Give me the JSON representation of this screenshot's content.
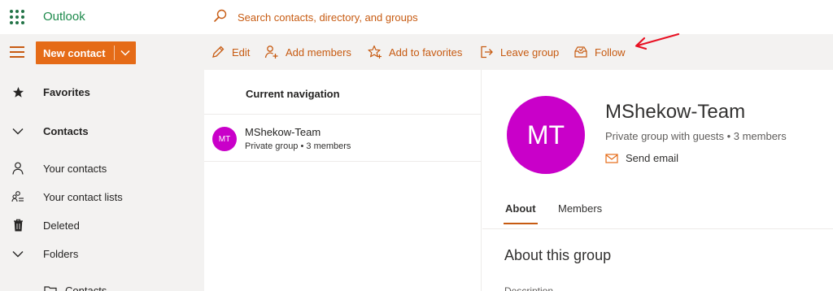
{
  "app": {
    "name": "Outlook"
  },
  "search": {
    "placeholder": "Search contacts, directory, and groups"
  },
  "toolbar": {
    "new_contact_label": "New contact",
    "commands": {
      "edit": "Edit",
      "add_members": "Add members",
      "add_to_favorites": "Add to favorites",
      "leave_group": "Leave group",
      "follow": "Follow"
    }
  },
  "sidebar": {
    "items": [
      {
        "label": "Favorites",
        "icon": "star-icon",
        "bold": true
      },
      {
        "label": "Contacts",
        "icon": "chevron-down-icon",
        "bold": true
      },
      {
        "label": "Your contacts",
        "icon": "person-icon"
      },
      {
        "label": "Your contact lists",
        "icon": "contact-list-icon"
      },
      {
        "label": "Deleted",
        "icon": "trash-icon"
      },
      {
        "label": "Folders",
        "icon": "chevron-down-icon"
      },
      {
        "label": "Contacts",
        "icon": "folder-icon"
      }
    ]
  },
  "list": {
    "header": "Current navigation",
    "items": [
      {
        "initials": "MT",
        "name": "MShekow-Team",
        "subtitle": "Private group • 3 members"
      }
    ]
  },
  "detail": {
    "initials": "MT",
    "name": "MShekow-Team",
    "subtitle": "Private group with guests • 3 members",
    "send_email": "Send email",
    "tabs": [
      "About",
      "Members"
    ],
    "active_tab": "About",
    "about_title": "About this group",
    "section_label_partial": "Description"
  },
  "colors": {
    "accent": "#c75b12",
    "primary_button": "#e56b17",
    "brand": "#1e8a4c",
    "avatar": "#c900c9",
    "annotation_arrow": "#e81123"
  }
}
